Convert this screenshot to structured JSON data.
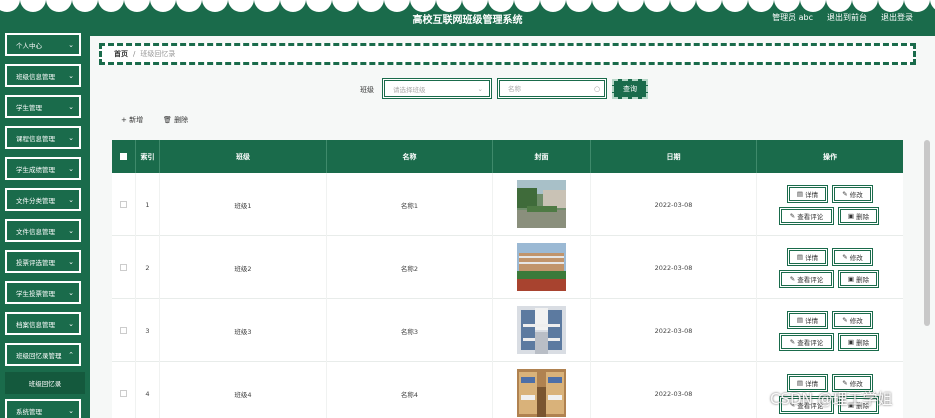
{
  "header": {
    "title": "高校互联网班级管理系统",
    "user": "管理员 abc",
    "front_link": "退出到前台",
    "logout": "退出登录",
    "color": "#1a6b4b"
  },
  "sidebar": {
    "items": [
      {
        "label": "个人中心"
      },
      {
        "label": "班级信息管理"
      },
      {
        "label": "学生管理"
      },
      {
        "label": "课程信息管理"
      },
      {
        "label": "学生成绩管理"
      },
      {
        "label": "文件分类管理"
      },
      {
        "label": "文件信息管理"
      },
      {
        "label": "投票评选管理"
      },
      {
        "label": "学生投票管理"
      },
      {
        "label": "档案信息管理"
      },
      {
        "label": "班级回忆录管理"
      },
      {
        "label": "系统管理"
      }
    ],
    "sub_item": "班级回忆录"
  },
  "breadcrumb": {
    "home": "首页",
    "separator": "/",
    "current": "班级回忆录"
  },
  "search": {
    "class_label": "班级",
    "class_placeholder": "请选择班级",
    "name_placeholder": "名称",
    "query_button": "查询"
  },
  "toolbar": {
    "add": "+ 新增",
    "delete": "删除"
  },
  "table": {
    "headers": [
      "索引",
      "班级",
      "名称",
      "封面",
      "日期",
      "操作"
    ],
    "rows": [
      {
        "index": "1",
        "class": "班级1",
        "name": "名称1",
        "date": "2022-03-08"
      },
      {
        "index": "2",
        "class": "班级2",
        "name": "名称2",
        "date": "2022-03-08"
      },
      {
        "index": "3",
        "class": "班级3",
        "name": "名称3",
        "date": "2022-03-08"
      },
      {
        "index": "4",
        "class": "班级4",
        "name": "名称4",
        "date": "2022-03-08"
      }
    ],
    "actions": {
      "detail": "详情",
      "edit": "修改",
      "comments": "查看评论",
      "delete": "删除"
    }
  },
  "watermark": "CSDN @理工学姐"
}
